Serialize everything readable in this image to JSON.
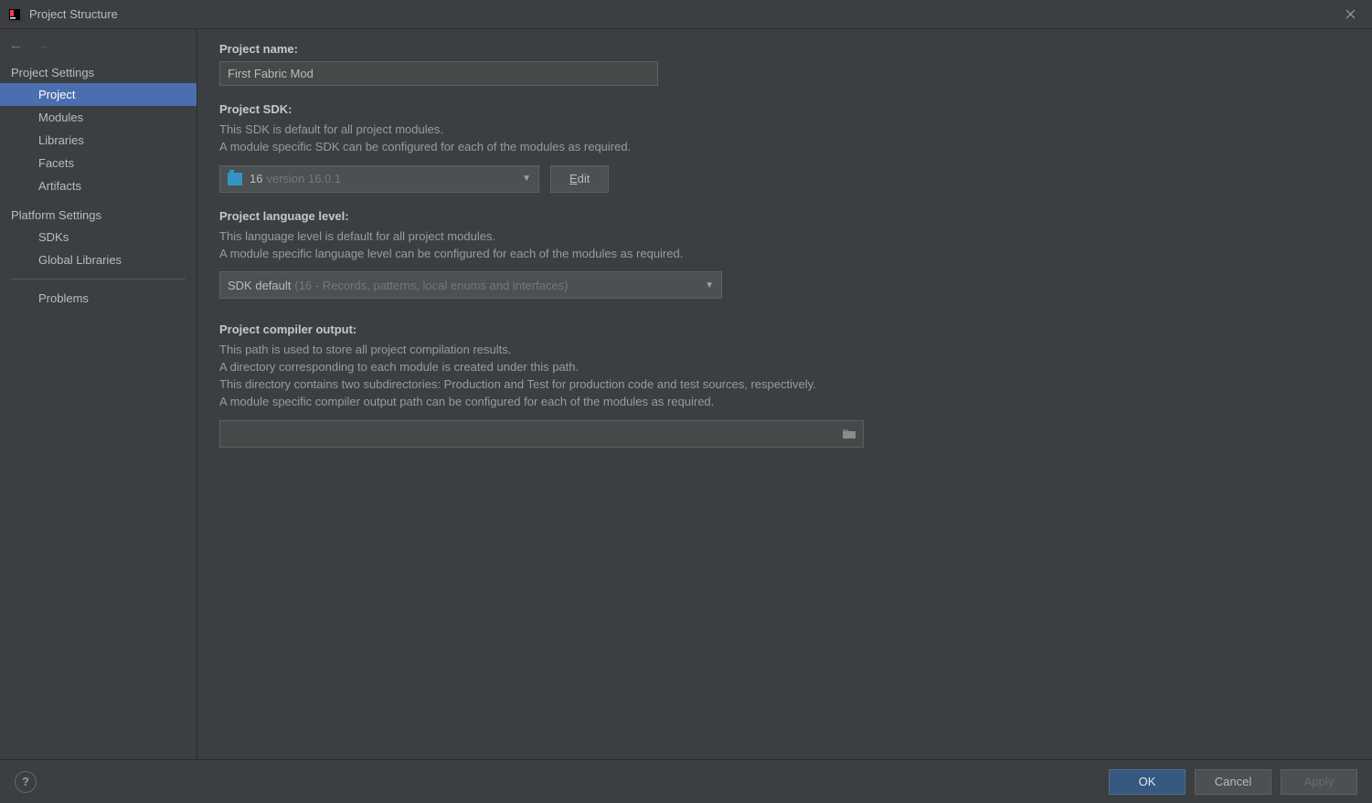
{
  "titlebar": {
    "title": "Project Structure"
  },
  "sidebar": {
    "section1": "Project Settings",
    "items1": [
      "Project",
      "Modules",
      "Libraries",
      "Facets",
      "Artifacts"
    ],
    "section2": "Platform Settings",
    "items2": [
      "SDKs",
      "Global Libraries"
    ],
    "items3": [
      "Problems"
    ],
    "selected": "Project"
  },
  "project": {
    "name_label": "Project name:",
    "name_value": "First Fabric Mod",
    "sdk_label": "Project SDK:",
    "sdk_desc1": "This SDK is default for all project modules.",
    "sdk_desc2": "A module specific SDK can be configured for each of the modules as required.",
    "sdk_selected": "16",
    "sdk_version": "version 16.0.1",
    "edit_button": "Edit",
    "lang_label": "Project language level:",
    "lang_desc1": "This language level is default for all project modules.",
    "lang_desc2": "A module specific language level can be configured for each of the modules as required.",
    "lang_selected": "SDK default",
    "lang_detail": "(16 - Records, patterns, local enums and interfaces)",
    "output_label": "Project compiler output:",
    "output_desc1": "This path is used to store all project compilation results.",
    "output_desc2": "A directory corresponding to each module is created under this path.",
    "output_desc3": "This directory contains two subdirectories: Production and Test for production code and test sources, respectively.",
    "output_desc4": "A module specific compiler output path can be configured for each of the modules as required.",
    "output_value": ""
  },
  "footer": {
    "ok": "OK",
    "cancel": "Cancel",
    "apply": "Apply"
  }
}
